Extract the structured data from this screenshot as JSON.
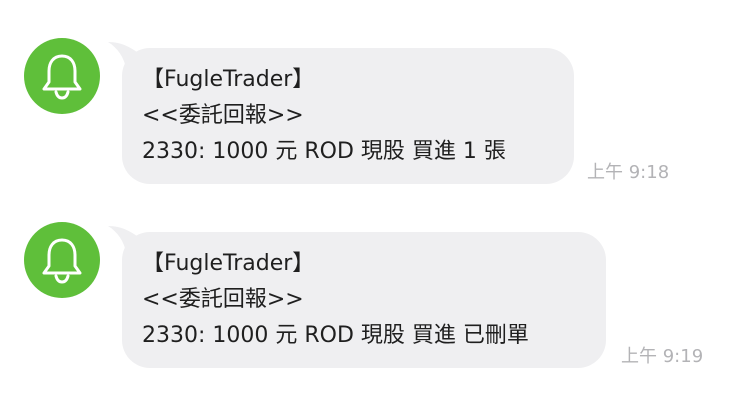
{
  "messages": [
    {
      "sender_icon": "bell-icon",
      "lines": [
        "【FugleTrader】",
        "<<委託回報>>",
        "2330: 1000 元 ROD 現股 買進 1 張"
      ],
      "time": "上午 9:18"
    },
    {
      "sender_icon": "bell-icon",
      "lines": [
        "【FugleTrader】",
        "<<委託回報>>",
        "2330: 1000 元 ROD 現股 買進 已刪單"
      ],
      "time": "上午 9:19"
    }
  ],
  "colors": {
    "avatar_bg": "#5fbf3a",
    "bubble_bg": "#efeff1",
    "text": "#1f1f1f",
    "timestamp": "#b3b3b6"
  }
}
